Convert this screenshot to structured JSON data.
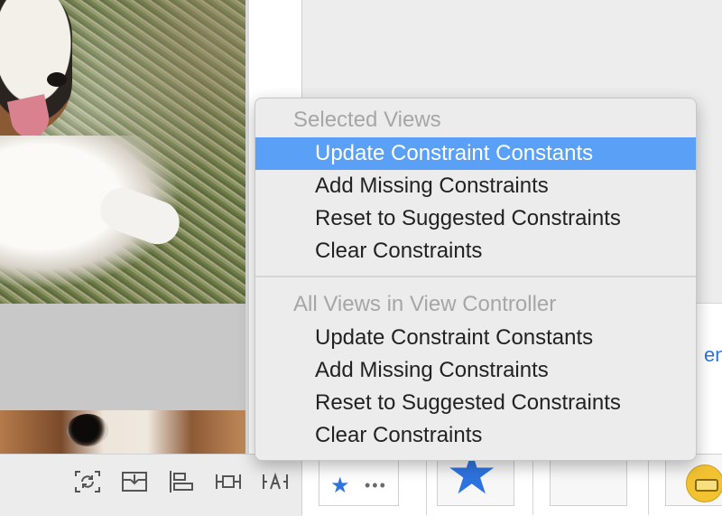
{
  "menu": {
    "sections": [
      {
        "header": "Selected Views",
        "items": [
          {
            "label": "Update Constraint Constants",
            "highlighted": true
          },
          {
            "label": "Add Missing Constraints"
          },
          {
            "label": "Reset to Suggested Constraints"
          },
          {
            "label": "Clear Constraints"
          }
        ]
      },
      {
        "header": "All Views in View Controller",
        "items": [
          {
            "label": "Update Constraint Constants"
          },
          {
            "label": "Add Missing Constraints"
          },
          {
            "label": "Reset to Suggested Constraints"
          },
          {
            "label": "Clear Constraints"
          }
        ]
      }
    ]
  },
  "toolbar": {
    "icons": [
      "update-frames-icon",
      "embed-in-stack-icon",
      "align-icon",
      "add-constraints-icon",
      "resolve-autolayout-issues-icon"
    ]
  },
  "library": {
    "cut_text": "en",
    "more_glyph": "•••"
  },
  "colors": {
    "highlight": "#5aa0f6",
    "accent": "#2d74e0",
    "header_text": "#a6a6a6"
  }
}
